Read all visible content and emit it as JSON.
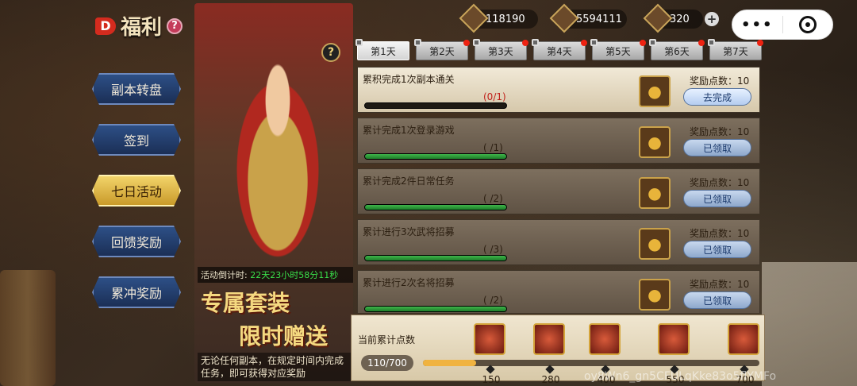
{
  "header": {
    "logo_letter": "D",
    "title": "福利",
    "help": "?"
  },
  "resources": [
    {
      "icon": "coin-icon",
      "value": "118190"
    },
    {
      "icon": "gold-bar-icon",
      "value": "5594111"
    },
    {
      "icon": "gem-icon",
      "value": "320"
    }
  ],
  "capsule": {
    "more": "•••"
  },
  "menu": [
    {
      "label": "副本转盘",
      "active": false
    },
    {
      "label": "签到",
      "active": false
    },
    {
      "label": "七日活动",
      "active": true
    },
    {
      "label": "回馈奖励",
      "active": false
    },
    {
      "label": "累冲奖励",
      "active": false
    }
  ],
  "hero": {
    "help": "?",
    "countdown_label": "活动倒计时:",
    "countdown_value": "22天23小时58分11秒",
    "promo_line1": "专属套装",
    "promo_line2": "限时赠送",
    "description": "无论任何副本，在规定时间内完成任务，即可获得对应奖励"
  },
  "tabs": [
    "第1天",
    "第2天",
    "第3天",
    "第4天",
    "第5天",
    "第6天",
    "第7天"
  ],
  "tasks": [
    {
      "name": "累积完成1次副本通关",
      "progress": "(0/1)",
      "fill": 0,
      "points_label": "奖励点数：10",
      "button": "去完成"
    },
    {
      "name": "累计完成1次登录游戏",
      "progress": "(  /1)",
      "fill": 1,
      "points_label": "奖励点数：10",
      "button": "已领取"
    },
    {
      "name": "累计完成2件日常任务",
      "progress": "(  /2)",
      "fill": 1,
      "points_label": "奖励点数：10",
      "button": "已领取"
    },
    {
      "name": "累计进行3次武将招募",
      "progress": "(  /3)",
      "fill": 1,
      "points_label": "奖励点数：10",
      "button": "已领取"
    },
    {
      "name": "累计进行2次名将招募",
      "progress": "(  /2)",
      "fill": 1,
      "points_label": "奖励点数：10",
      "button": "已领取"
    }
  ],
  "bottom": {
    "label": "当前累计点数",
    "score": "110/700",
    "progress_fraction": 0.157,
    "milestones": [
      {
        "value": "150",
        "icon": "general-portrait-icon"
      },
      {
        "value": "280",
        "icon": "shuriken-icon"
      },
      {
        "value": "400",
        "icon": "armor-icon"
      },
      {
        "value": "550",
        "icon": "warhorse-icon"
      },
      {
        "value": "700",
        "icon": "golden-beast-icon"
      }
    ]
  },
  "watermark": "oy8Wn6_gn5CFULqKke83o5flYMFo"
}
